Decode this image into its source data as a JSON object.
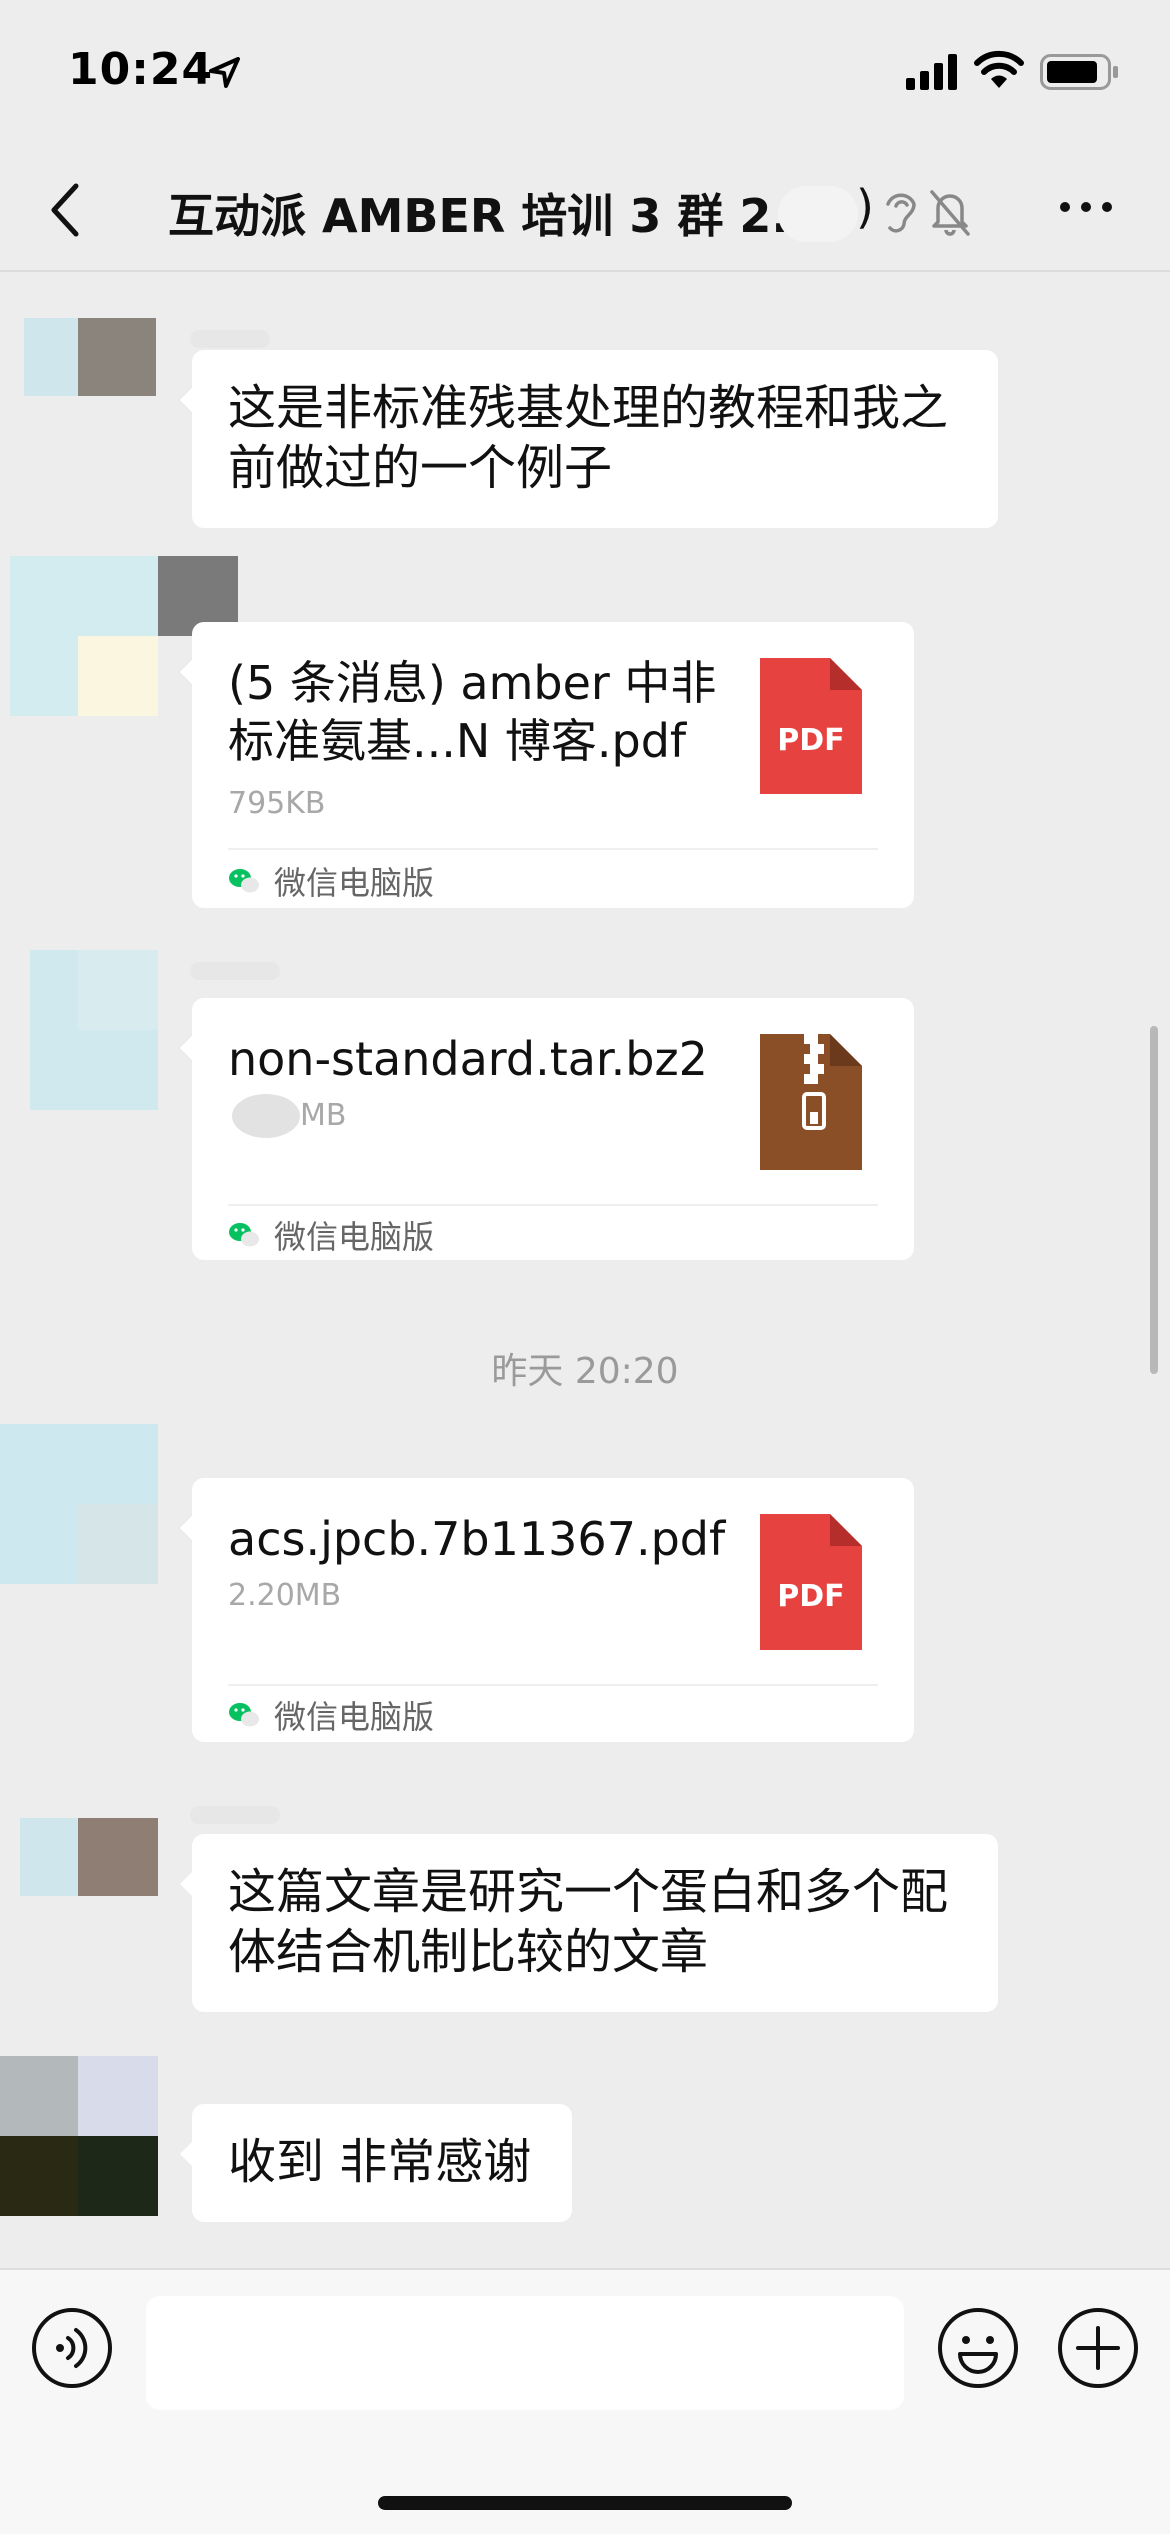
{
  "status_bar": {
    "time": "10:24"
  },
  "header": {
    "title": "互动派 AMBER 培训 3 群 2...",
    "member_count_suffix": ")"
  },
  "messages": [
    {
      "type": "text",
      "text_line1": "这是非标准残基处理的教程和我之",
      "text_line2": "前做过的一个例子"
    },
    {
      "type": "file",
      "name_line1": "(5 条消息) amber 中非",
      "name_line2": "标准氨基...N 博客.pdf",
      "size": "795KB",
      "source": "微信电脑版",
      "icon": "PDF"
    },
    {
      "type": "file",
      "name_line1": "non-standard.tar.bz2",
      "name_line2": "",
      "size": "MB",
      "source": "微信电脑版",
      "icon": "zip-icon"
    },
    {
      "type": "file",
      "name_line1": "acs.jpcb.7b11367.pdf",
      "name_line2": "",
      "size": "2.20MB",
      "source": "微信电脑版",
      "icon": "PDF"
    },
    {
      "type": "text",
      "text_line1": "这篇文章是研究一个蛋白和多个配",
      "text_line2": "体结合机制比较的文章"
    },
    {
      "type": "text",
      "text_line1": "收到 非常感谢",
      "text_line2": ""
    }
  ],
  "time_divider": "昨天 20:20",
  "input": {
    "value": ""
  },
  "colors": {
    "background": "#ededed",
    "bubble": "#ffffff",
    "pdf_red": "#e64340",
    "zip_brown": "#8b4f27",
    "wechat_green": "#07c160"
  }
}
